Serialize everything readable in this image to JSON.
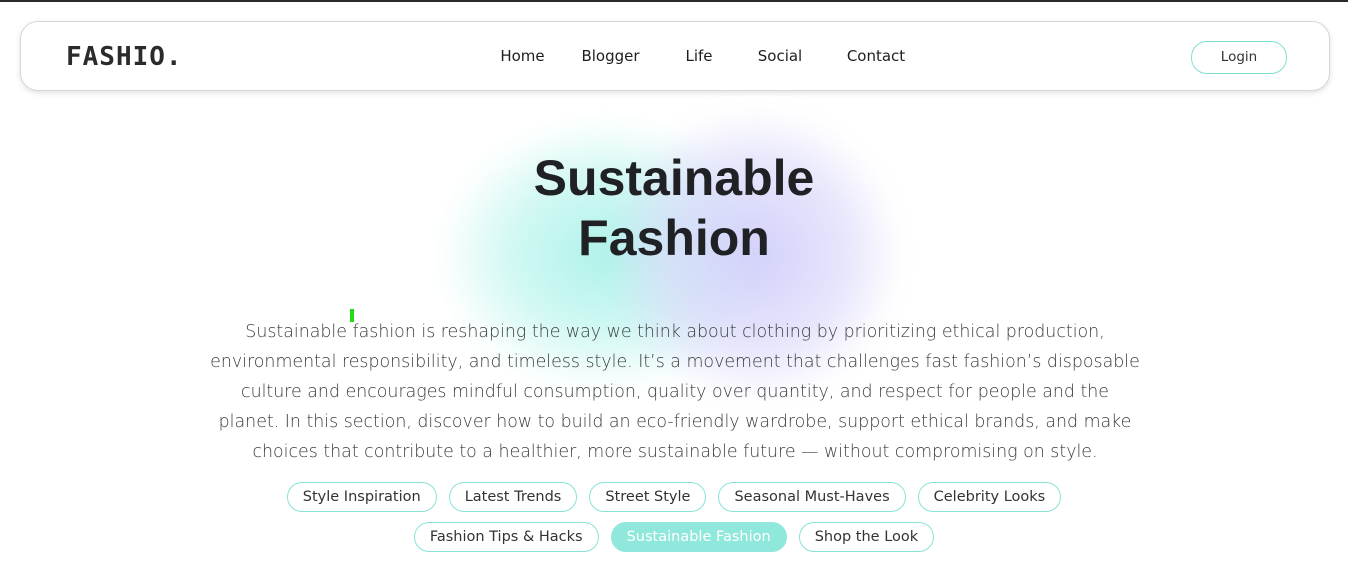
{
  "brand": {
    "logo_text": "FASHIO."
  },
  "nav": {
    "home": "Home",
    "blogger": "Blogger",
    "life": "Life",
    "social": "Social",
    "contact": "Contact",
    "login": "Login"
  },
  "hero": {
    "title_line1": "Sustainable",
    "title_line2": "Fashion",
    "description": "Sustainable fashion is reshaping the way we think about clothing by prioritizing ethical production, environmental responsibility, and timeless style. It’s a movement that challenges fast fashion’s disposable culture and encourages mindful consumption, quality over quantity, and respect for people and the planet. In this section, discover how to build an eco-friendly wardrobe, support ethical brands, and make choices that contribute to a healthier, more sustainable future — without compromising on style."
  },
  "tags": {
    "row1": [
      "Style Inspiration",
      "Latest Trends",
      "Street Style",
      "Seasonal Must-Haves",
      "Celebrity Looks"
    ],
    "row2": [
      "Fashion Tips & Hacks",
      "Sustainable Fashion",
      "Shop the Look"
    ],
    "active": "Sustainable Fashion"
  },
  "colors": {
    "accent_teal": "#8fe8db",
    "accent_purple": "#d0cefa",
    "text_dark": "#1f2124"
  }
}
